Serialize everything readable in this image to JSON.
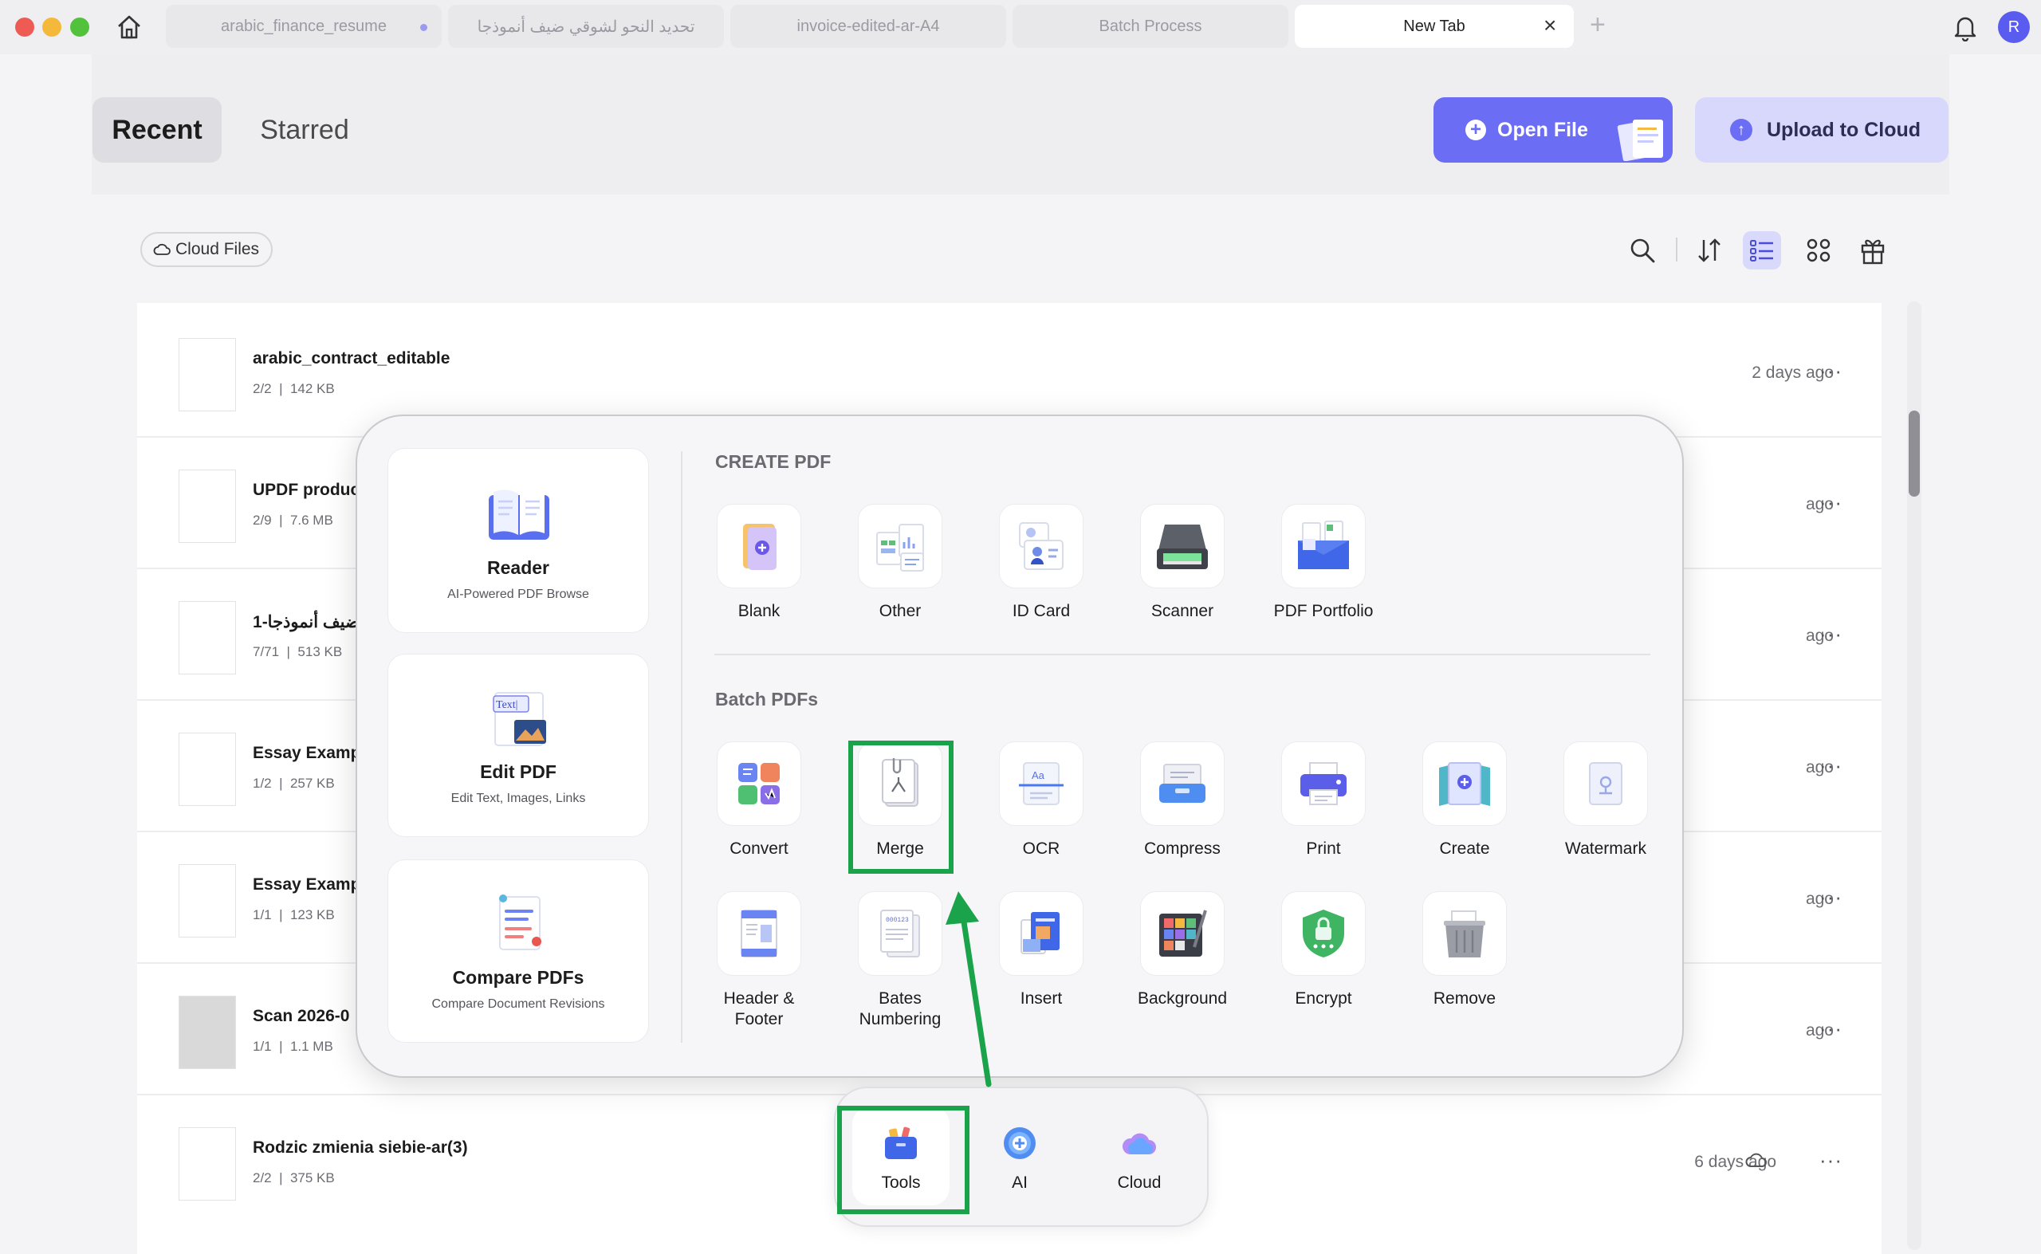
{
  "window": {
    "tabs": [
      {
        "label": "arabic_finance_resume",
        "modified": true
      },
      {
        "label": "تحديد النحو لشوقي ضيف أنموذجا"
      },
      {
        "label": "invoice-edited-ar-A4"
      },
      {
        "label": "Batch Process"
      },
      {
        "label": "New Tab",
        "active": true
      }
    ],
    "user_initial": "R"
  },
  "header": {
    "recent_label": "Recent",
    "starred_label": "Starred",
    "open_file_label": "Open File",
    "upload_label": "Upload to Cloud",
    "accent_color": "#6b6df5"
  },
  "toolbar": {
    "cloud_files_label": "Cloud Files",
    "icons": [
      "search-icon",
      "sort-icon",
      "list-view-icon",
      "grid-view-icon",
      "gift-icon"
    ]
  },
  "files": [
    {
      "name": "arabic_contract_editable",
      "pages": "2/2",
      "size": "142 KB",
      "date": "2 days ago"
    },
    {
      "name": "UPDF produc",
      "pages": "2/9",
      "size": "7.6 MB",
      "date": "ago"
    },
    {
      "name": "ضيف أنموذجا-1",
      "pages": "7/71",
      "size": "513 KB",
      "date": "ago"
    },
    {
      "name": "Essay Examp",
      "pages": "1/2",
      "size": "257 KB",
      "date": "ago"
    },
    {
      "name": "Essay Examp",
      "pages": "1/1",
      "size": "123 KB",
      "date": "ago"
    },
    {
      "name": "Scan 2026-0",
      "pages": "1/1",
      "size": "1.1 MB",
      "date": "ago"
    },
    {
      "name": "Rodzic zmienia siebie-ar(3)",
      "pages": "2/2",
      "size": "375 KB",
      "date": "6 days ago",
      "cloud": true
    }
  ],
  "tools_panel": {
    "cards": [
      {
        "title": "Reader",
        "subtitle": "AI-Powered PDF Browse"
      },
      {
        "title": "Edit PDF",
        "subtitle": "Edit Text, Images, Links",
        "icon_text": "Text|"
      },
      {
        "title": "Compare PDFs",
        "subtitle": "Compare Document Revisions"
      }
    ],
    "create_heading": "CREATE PDF",
    "create_items": [
      "Blank",
      "Other",
      "ID Card",
      "Scanner",
      "PDF Portfolio"
    ],
    "batch_heading": "Batch PDFs",
    "batch_row1": [
      "Convert",
      "Merge",
      "OCR",
      "Compress",
      "Print",
      "Create",
      "Watermark"
    ],
    "batch_row2": [
      "Header &\nFooter",
      "Bates\nNumbering",
      "Insert",
      "Background",
      "Encrypt",
      "Remove"
    ],
    "highlighted_item": "Merge",
    "highlight_color": "#1aa34a"
  },
  "dock": {
    "items": [
      "Tools",
      "AI",
      "Cloud"
    ],
    "active": "Tools"
  }
}
